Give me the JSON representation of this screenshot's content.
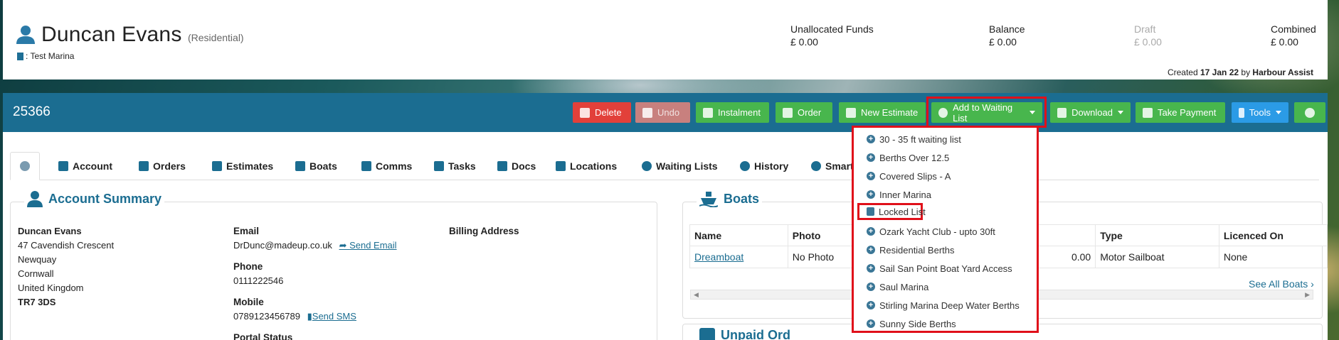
{
  "header": {
    "customer_name": "Duncan Evans",
    "customer_type": "(Residential)",
    "marina": ": Test Marina",
    "funds": [
      {
        "label": "Unallocated Funds",
        "value": "£ 0.00",
        "muted": false
      },
      {
        "label": "Balance",
        "value": "£ 0.00",
        "muted": false
      },
      {
        "label": "Draft",
        "value": "£ 0.00",
        "muted": true
      },
      {
        "label": "Combined",
        "value": "£ 0.00",
        "muted": false
      }
    ],
    "created_prefix": "Created",
    "created_date": "17 Jan 22",
    "created_by_prefix": "by",
    "created_by": "Harbour Assist"
  },
  "toolbar": {
    "account_number": "25366",
    "buttons": {
      "delete": "Delete",
      "undo": "Undo",
      "instalment": "Instalment",
      "order": "Order",
      "new_estimate": "New Estimate",
      "add_waiting_list": "Add to Waiting List",
      "download": "Download",
      "take_payment": "Take Payment",
      "tools": "Tools"
    }
  },
  "tabs": [
    "Account",
    "Orders",
    "Estimates",
    "Boats",
    "Comms",
    "Tasks",
    "Docs",
    "Locations",
    "Waiting Lists",
    "History",
    "Smart"
  ],
  "account_summary": {
    "title": "Account Summary",
    "address": {
      "name": "Duncan Evans",
      "line1": "47 Cavendish Crescent",
      "line2": "Newquay",
      "line3": "Cornwall",
      "line4": "United Kingdom",
      "postcode": "TR7 3DS"
    },
    "email_label": "Email",
    "email": "DrDunc@madeup.co.uk",
    "send_email": "Send Email",
    "phone_label": "Phone",
    "phone": "0111222546",
    "mobile_label": "Mobile",
    "mobile": "0789123456789",
    "send_sms": "Send SMS",
    "portal_status_label": "Portal Status",
    "billing_label": "Billing Address"
  },
  "boats_panel": {
    "title": "Boats",
    "columns": {
      "name": "Name",
      "photo": "Photo",
      "type": "Type",
      "licenced_on": "Licenced On"
    },
    "row": {
      "name": "Dreamboat",
      "photo": "No Photo",
      "partial_value": "0.00",
      "type": "Motor Sailboat",
      "licenced_on": "None"
    },
    "see_all": "See All Boats"
  },
  "upcoming_orders_title_partial": "Unpaid Ord",
  "waiting_list_menu": {
    "items": [
      {
        "label": "30 - 35 ft waiting list",
        "icon": "plus-circle-icon"
      },
      {
        "label": "Berths Over 12.5",
        "icon": "plus-circle-icon"
      },
      {
        "label": "Covered Slips - A",
        "icon": "plus-circle-icon"
      },
      {
        "label": "Inner Marina",
        "icon": "plus-circle-icon"
      },
      {
        "label": "Locked List",
        "icon": "lock-icon"
      },
      {
        "label": "Ozark Yacht Club - upto 30ft",
        "icon": "plus-circle-icon"
      },
      {
        "label": "Residential Berths",
        "icon": "plus-circle-icon"
      },
      {
        "label": "Sail San Point Boat Yard Access",
        "icon": "plus-circle-icon"
      },
      {
        "label": "Saul Marina",
        "icon": "plus-circle-icon"
      },
      {
        "label": "Stirling Marina Deep Water Berths",
        "icon": "plus-circle-icon"
      },
      {
        "label": "Sunny Side Berths",
        "icon": "plus-circle-icon"
      }
    ]
  },
  "colors": {
    "toolbar": "#1b6d91",
    "green": "#48b64d",
    "red": "#e2403a",
    "blue": "#2b9be6",
    "highlight": "#e0101a"
  }
}
